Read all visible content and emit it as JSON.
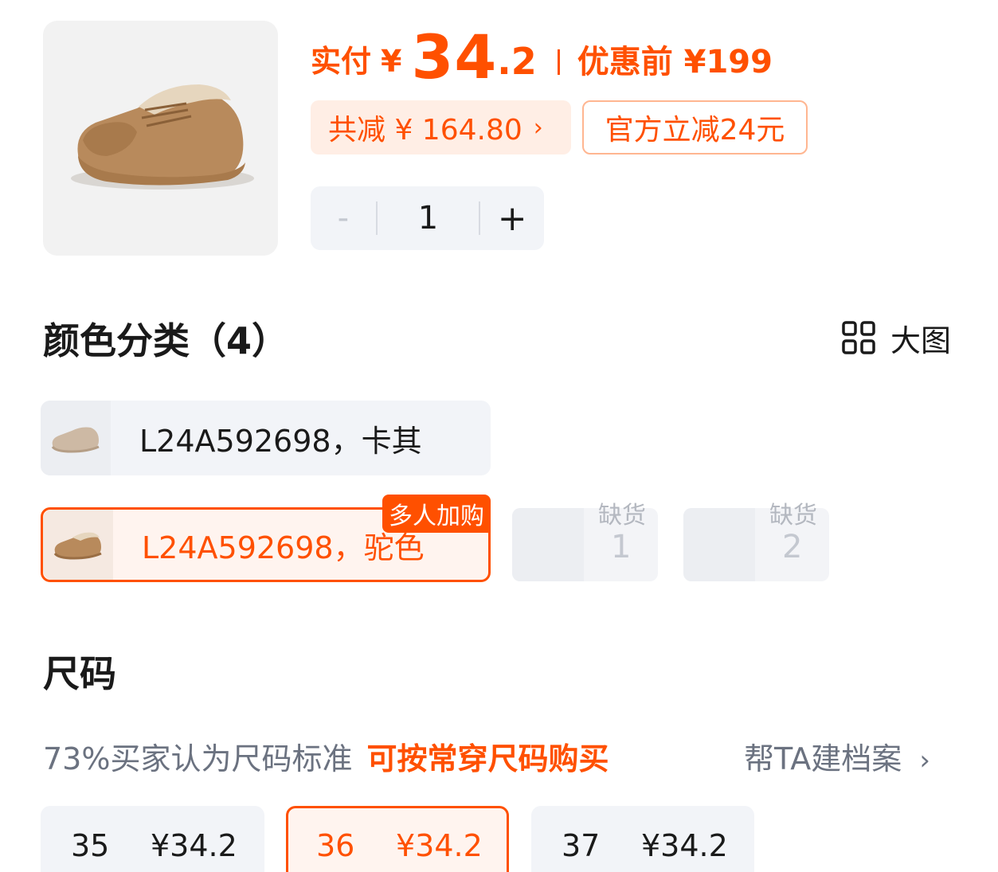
{
  "price": {
    "prefix": "实付",
    "currency": "¥",
    "integer": "34",
    "decimal": ".2",
    "original": "优惠前 ¥199",
    "discount": "共减 ¥ 164.80",
    "discount_chevron": "›",
    "coupon": "官方立减24元"
  },
  "quantity": {
    "minus": "-",
    "value": "1",
    "plus": "+"
  },
  "color_section": {
    "title": "颜色分类（4）",
    "big_image_label": "大图",
    "big_image_icon": "grid-icon",
    "options": [
      {
        "label": "L24A592698，卡其",
        "selected": false
      },
      {
        "label": "L24A592698，驼色",
        "selected": true,
        "badge": "多人加购"
      }
    ],
    "out_of_stock": [
      {
        "status": "缺货",
        "label": "1"
      },
      {
        "status": "缺货",
        "label": "2"
      }
    ]
  },
  "size_section": {
    "title": "尺码",
    "tip": "73%买家认为尺码标准",
    "tip_highlight": "可按常穿尺码购买",
    "archive_link": "帮TA建档案",
    "archive_chevron": "›",
    "sizes": [
      {
        "size": "35",
        "price": "¥34.2",
        "selected": false
      },
      {
        "size": "36",
        "price": "¥34.2",
        "selected": true
      },
      {
        "size": "37",
        "price": "¥34.2",
        "selected": false
      }
    ]
  },
  "colors": {
    "accent": "#ff5000",
    "chip_bg": "#f2f4f8",
    "selected_bg": "#fff4ef"
  }
}
